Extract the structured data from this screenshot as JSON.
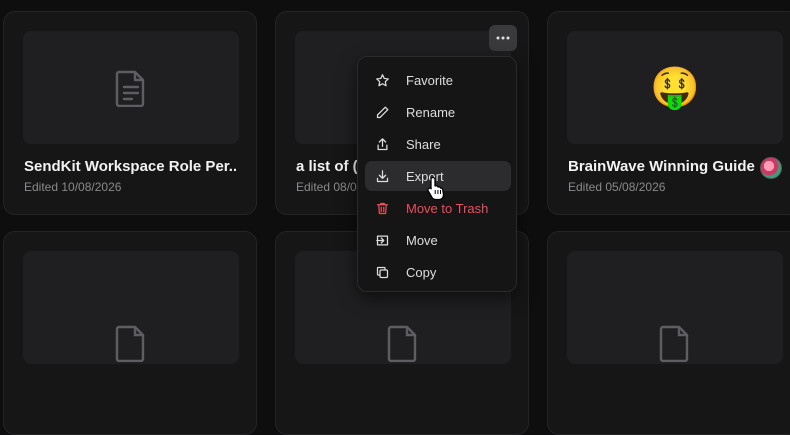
{
  "cards": [
    {
      "title": "SendKit Workspace Role Per...",
      "edited": "Edited 10/08/2026",
      "thumb_icon": "document-icon"
    },
    {
      "title": "a list of (c",
      "edited": "Edited 08/0",
      "thumb_icon": "none"
    },
    {
      "title": "BrainWave Winning Guide",
      "edited": "Edited 05/08/2026",
      "thumb_emoji": "🤑"
    }
  ],
  "context_menu": {
    "items": [
      {
        "label": "Favorite",
        "icon": "star-icon"
      },
      {
        "label": "Rename",
        "icon": "pencil-icon"
      },
      {
        "label": "Share",
        "icon": "share-icon"
      },
      {
        "label": "Export",
        "icon": "download-icon",
        "state": "hovered"
      },
      {
        "label": "Move to Trash",
        "icon": "trash-icon",
        "color": "#e8505b"
      },
      {
        "label": "Move",
        "icon": "move-icon"
      },
      {
        "label": "Copy",
        "icon": "copy-icon"
      }
    ]
  },
  "colors": {
    "background": "#0e0e0f",
    "card": "#161617",
    "danger": "#e8505b"
  }
}
